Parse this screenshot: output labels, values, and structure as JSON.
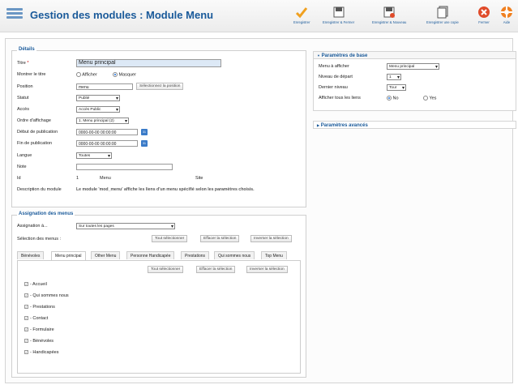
{
  "header": {
    "title": "Gestion des modules : Module Menu"
  },
  "toolbar": {
    "save": "Enregistrer",
    "save_close": "Enregistrer & Fermer",
    "save_new": "Enregistrer & Nouveau",
    "save_copy": "Enregistrer une copie",
    "close": "Fermer",
    "help": "Aide"
  },
  "details": {
    "legend": "Détails",
    "title_label": "Titre",
    "required": "*",
    "title_value": "Menu principal",
    "show_title_label": "Montrer le titre",
    "show": "Afficher",
    "hide": "Masquer",
    "position_label": "Position",
    "position_value": "menu",
    "position_btn": "Sélectionnez la position",
    "status_label": "Statut",
    "status_value": "Publié",
    "access_label": "Accès",
    "access_value": "Accès Public",
    "order_label": "Ordre d'affichage",
    "order_value": "1. Menu principal (2)",
    "pub_start_label": "Début de publication",
    "pub_start_value": "0000-00-00 00:00:00",
    "pub_end_label": "Fin de publication",
    "pub_end_value": "0000-00-00 00:00:00",
    "lang_label": "Langue",
    "lang_value": "Toutes",
    "note_label": "Note",
    "note_value": "",
    "id_label": "Id",
    "id_value": "1",
    "id_module": "Menu",
    "id_site": "Site",
    "desc_label": "Description du module",
    "desc_value": "Le module 'mod_menu' affiche les liens d'un menu spécifié selon les paramètres choisis."
  },
  "basic": {
    "title": "Paramètres de base",
    "menu_label": "Menu à afficher",
    "menu_value": "Menu principal",
    "start_label": "Niveau de départ",
    "start_value": "1",
    "end_label": "Dernier niveau",
    "end_value": "Tour",
    "all_label": "Afficher tous les liens",
    "no": "No",
    "yes": "Yes"
  },
  "advanced": {
    "title": "Paramètres avancés"
  },
  "assign": {
    "legend": "Assignation des menus",
    "assign_label": "Assignation à...",
    "assign_value": "Sur toutes les pages",
    "select_label": "Sélection des menus :",
    "btn_all": "Tout sélectionner",
    "btn_clear": "Effacer la sélection",
    "btn_invert": "Inverser la sélection",
    "tabs": [
      "Bénévoles",
      "Menu principal",
      "Other Menu",
      "Personne Handicapée",
      "Prestations",
      "Qui sommes nous",
      "Top Menu"
    ],
    "items": [
      "- Accueil",
      "- Qui sommes nous",
      "- Prestations",
      "- Contact",
      "- Formulaire",
      "- Bénévoles",
      "- Handicapées"
    ]
  },
  "colors": {
    "accent": "#1a5a9a",
    "close": "#e04b2a"
  },
  "icons": [
    "menu-icon",
    "check-icon",
    "save-icon",
    "save-close-icon",
    "save-new-icon",
    "copy-icon",
    "close-icon",
    "help-icon",
    "calendar-icon",
    "expand-icon"
  ]
}
